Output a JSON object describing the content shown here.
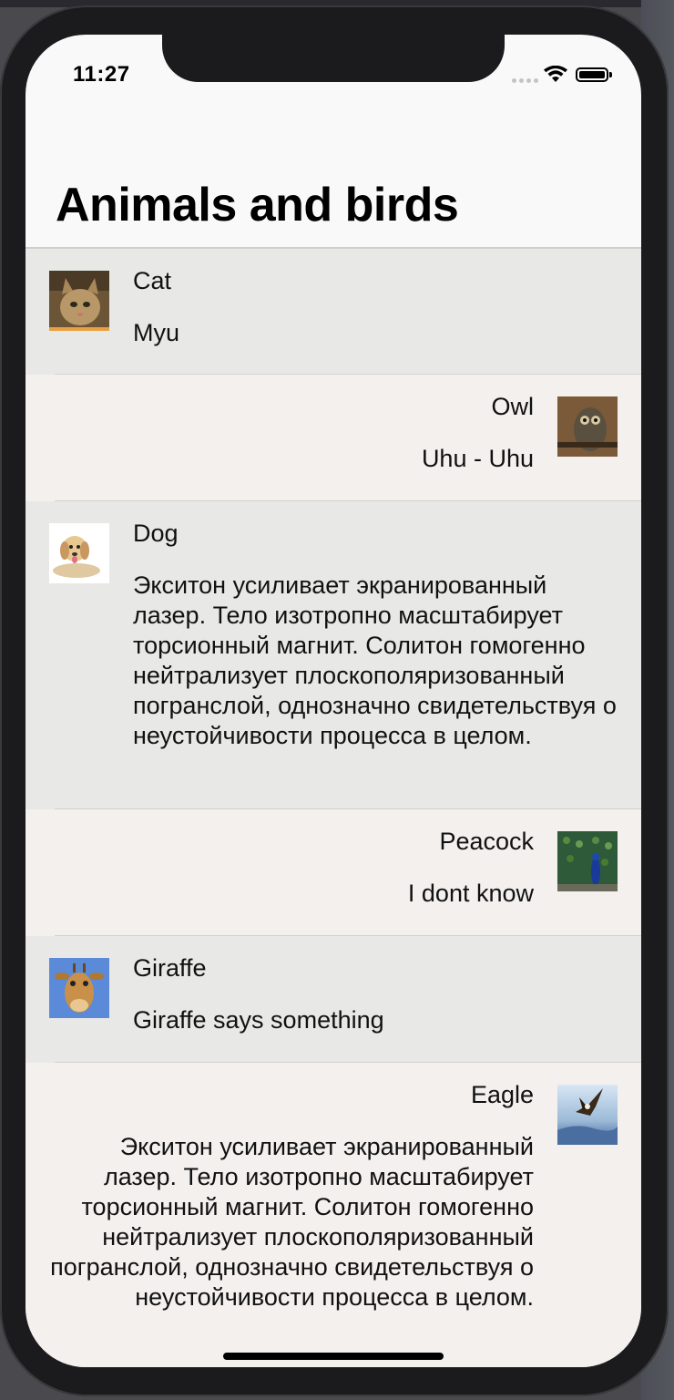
{
  "status_bar": {
    "time": "11:27",
    "icons": [
      "signal-icon",
      "wifi-icon",
      "battery-icon"
    ]
  },
  "nav": {
    "title": "Animals and birds"
  },
  "items": [
    {
      "title": "Cat",
      "text": "Myu",
      "image": "cat-photo",
      "align": "left"
    },
    {
      "title": "Owl",
      "text": "Uhu - Uhu",
      "image": "owl-photo",
      "align": "right"
    },
    {
      "title": "Dog",
      "text": "Экситон усиливает экранированный лазер. Тело изотропно масштабирует торсионный магнит. Солитон гомогенно нейтрализует плоскополяризованный погранслой, однозначно свидетельствуя о неустойчивости процесса в целом.",
      "image": "dog-photo",
      "align": "left"
    },
    {
      "title": "Peacock",
      "text": "I dont know",
      "image": "peacock-photo",
      "align": "right"
    },
    {
      "title": "Giraffe",
      "text": "Giraffe says something",
      "image": "giraffe-photo",
      "align": "left"
    },
    {
      "title": "Eagle",
      "text": "Экситон усиливает экранированный лазер. Тело изотропно масштабирует торсионный магнит. Солитон гомогенно нейтрализует плоскополяризованный погранслой, однозначно свидетельствуя о неустойчивости процесса в целом.",
      "image": "eagle-photo",
      "align": "right"
    }
  ],
  "colors": {
    "row_left_bg": "#e8e9e7",
    "row_right_bg": "#f3f0ee",
    "nav_bg": "#f9f9f9"
  }
}
